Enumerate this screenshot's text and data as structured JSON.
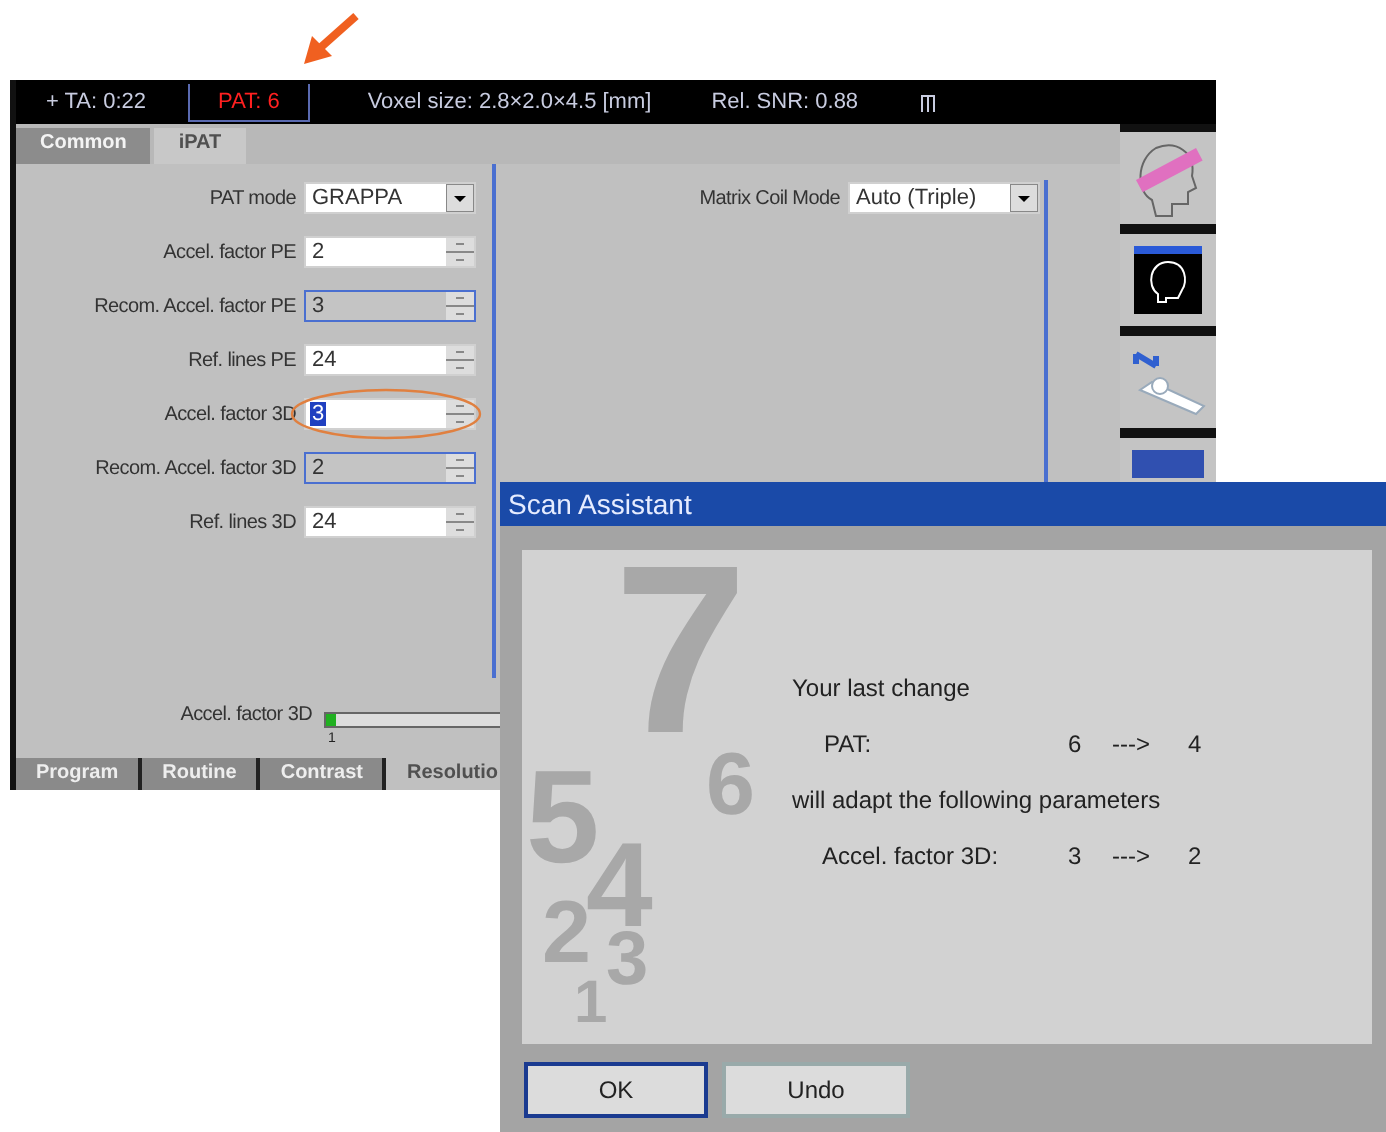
{
  "header": {
    "items": [
      {
        "text": "+ TA: 0:22",
        "highlighted": false
      },
      {
        "text": "PAT: 6",
        "highlighted": true
      },
      {
        "text": "Voxel size: 2.8×2.0×4.5 [mm]",
        "highlighted": false
      },
      {
        "text": "Rel. SNR: 0.88",
        "highlighted": false
      }
    ]
  },
  "top_tabs": [
    {
      "label": "Common",
      "selected": false
    },
    {
      "label": "iPAT",
      "selected": true
    }
  ],
  "fields": [
    {
      "label": "PAT mode",
      "value": "GRAPPA",
      "kind": "dropdown",
      "disabled": false,
      "focused": false,
      "circled": false
    },
    {
      "label": "Accel. factor PE",
      "value": "2",
      "kind": "spin",
      "disabled": false,
      "focused": false,
      "circled": false
    },
    {
      "label": "Recom. Accel. factor PE",
      "value": "3",
      "kind": "spin",
      "disabled": true,
      "focused": false,
      "circled": false
    },
    {
      "label": "Ref. lines PE",
      "value": "24",
      "kind": "spin",
      "disabled": false,
      "focused": false,
      "circled": false
    },
    {
      "label": "Accel. factor 3D",
      "value": "3",
      "kind": "spin",
      "disabled": false,
      "focused": true,
      "circled": true
    },
    {
      "label": "Recom. Accel. factor 3D",
      "value": "2",
      "kind": "spin",
      "disabled": true,
      "focused": false,
      "circled": false
    },
    {
      "label": "Ref. lines 3D",
      "value": "24",
      "kind": "spin",
      "disabled": false,
      "focused": false,
      "circled": false
    }
  ],
  "matrix": {
    "label": "Matrix Coil Mode",
    "value": "Auto (Triple)"
  },
  "slider": {
    "label": "Accel. factor 3D",
    "level": 0.04,
    "tick": "1"
  },
  "bottom_tabs": [
    {
      "label": "Program",
      "selected": false
    },
    {
      "label": "Routine",
      "selected": false
    },
    {
      "label": "Contrast",
      "selected": false
    },
    {
      "label": "Resolutio",
      "selected": true
    }
  ],
  "dialog": {
    "title": "Scan Assistant",
    "digits": [
      "7",
      "6",
      "5",
      "4",
      "2",
      "3",
      "1"
    ],
    "intro": "Your last change",
    "change": {
      "label": "PAT:",
      "from": "6",
      "arrow": "--->",
      "to": "4"
    },
    "middle": "will adapt the following parameters",
    "params": [
      {
        "label": "Accel. factor 3D:",
        "from": "3",
        "arrow": "--->",
        "to": "2"
      }
    ],
    "buttons": [
      {
        "label": "OK",
        "focused": true
      },
      {
        "label": "Undo",
        "focused": false
      }
    ]
  }
}
